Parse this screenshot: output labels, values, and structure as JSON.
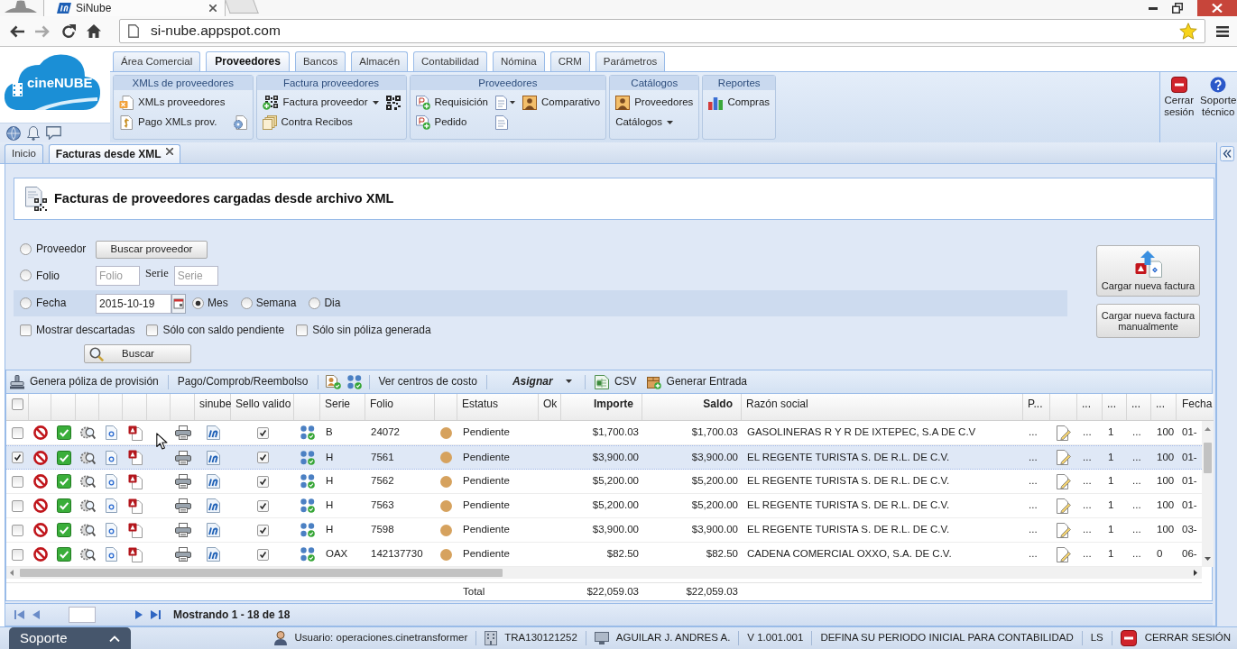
{
  "browser": {
    "tab": {
      "title": "SiNube"
    },
    "url": "si-nube.appspot.com"
  },
  "logo": {
    "text": "cineNUBE"
  },
  "main_tabs": [
    {
      "label": "Área Comercial",
      "selected": false
    },
    {
      "label": "Proveedores",
      "selected": true
    },
    {
      "label": "Bancos",
      "selected": false
    },
    {
      "label": "Almacén",
      "selected": false
    },
    {
      "label": "Contabilidad",
      "selected": false
    },
    {
      "label": "Nómina",
      "selected": false
    },
    {
      "label": "CRM",
      "selected": false
    },
    {
      "label": "Parámetros",
      "selected": false
    }
  ],
  "ribbon": [
    {
      "title": "XMLs de proveedores",
      "rows": [
        [
          {
            "kind": "button",
            "label": "XMLs proveedores"
          }
        ],
        [
          {
            "kind": "button",
            "label": "Pago XMLs prov."
          },
          {
            "kind": "icon"
          }
        ]
      ]
    },
    {
      "title": "Factura proveedores",
      "rows": [
        [
          {
            "kind": "menu",
            "label": "Factura proveedor"
          },
          {
            "kind": "icon"
          }
        ],
        [
          {
            "kind": "button",
            "label": "Contra Recibos"
          }
        ]
      ]
    },
    {
      "title": "Proveedores",
      "rows": [
        [
          {
            "kind": "button",
            "label": "Requisición"
          },
          {
            "kind": "iconmenu"
          },
          {
            "kind": "button",
            "label": "Comparativo"
          }
        ],
        [
          {
            "kind": "button",
            "label": "Pedido"
          },
          {
            "kind": "icon"
          }
        ]
      ]
    },
    {
      "title": "Catálogos",
      "rows": [
        [
          {
            "kind": "button",
            "label": "Proveedores"
          }
        ],
        [
          {
            "kind": "textmenu",
            "label": "Catálogos"
          }
        ]
      ]
    },
    {
      "title": "Reportes",
      "rows": [
        [
          {
            "kind": "button",
            "label": "Compras"
          }
        ]
      ]
    }
  ],
  "session_buttons": [
    {
      "kind": "logout",
      "label": "Cerrar sesión"
    },
    {
      "kind": "help",
      "label": "Soporte técnico"
    }
  ],
  "document_tabs": [
    {
      "label": "Inicio",
      "selected": false,
      "closable": false
    },
    {
      "label": "Facturas desde XML",
      "selected": true,
      "closable": true
    }
  ],
  "page_title": "Facturas de proveedores cargadas desde archivo XML",
  "filters": {
    "criteria": [
      {
        "kind": "button",
        "label": "Proveedor",
        "selected": false,
        "highlighted": false,
        "button": "Buscar proveedor"
      },
      {
        "kind": "fields",
        "label": "Folio",
        "selected": false,
        "highlighted": false,
        "fields": [
          {
            "placeholder": "Folio"
          },
          {
            "label": "Serie",
            "placeholder": "Serie"
          }
        ]
      },
      {
        "kind": "date",
        "label": "Fecha",
        "selected": false,
        "highlighted": true,
        "value": "2015-10-19",
        "periods": [
          {
            "label": "Mes",
            "selected": true
          },
          {
            "label": "Semana",
            "selected": false
          },
          {
            "label": "Dia",
            "selected": false
          }
        ]
      }
    ],
    "options": [
      {
        "label": "Mostrar descartadas",
        "checked": false
      },
      {
        "label": "Sólo con saldo pendiente",
        "checked": false
      },
      {
        "label": "Sólo sin póliza generada",
        "checked": false
      }
    ],
    "search_button": "Buscar"
  },
  "upload_buttons": [
    {
      "kind": "icon",
      "label": "Cargar nueva factura"
    },
    {
      "kind": "text",
      "label": "Cargar nueva factura manualmente"
    }
  ],
  "toolbar": [
    [
      {
        "kind": "icon-button",
        "label": "Genera póliza de provisión"
      }
    ],
    [
      {
        "kind": "button",
        "label": "Pago/Comprob/Reembolso"
      }
    ],
    [
      {
        "kind": "icon"
      },
      {
        "kind": "icon"
      }
    ],
    [
      {
        "kind": "button",
        "label": "Ver centros de costo"
      }
    ],
    [
      {
        "kind": "menu",
        "label": "Asignar"
      }
    ],
    [
      {
        "kind": "icon-button",
        "label": "CSV"
      },
      {
        "kind": "icon-button",
        "label": "Generar Entrada"
      }
    ]
  ],
  "grid": {
    "columns": [
      {
        "kind": "select",
        "checked": false
      },
      {
        "kind": "icon"
      },
      {
        "kind": "icon"
      },
      {
        "kind": "icon"
      },
      {
        "kind": "icon"
      },
      {
        "kind": "icon"
      },
      {
        "kind": "blank"
      },
      {
        "kind": "icon"
      },
      {
        "kind": "icon",
        "label": "sinube"
      },
      {
        "kind": "check",
        "label": "Sello valido"
      },
      {
        "kind": "icon"
      },
      {
        "kind": "text",
        "label": "Serie"
      },
      {
        "kind": "text",
        "label": "Folio"
      },
      {
        "kind": "dot"
      },
      {
        "kind": "text",
        "label": "Estatus",
        "total": "Total"
      },
      {
        "kind": "blank",
        "label": "Ok"
      },
      {
        "kind": "money",
        "label": "Importe",
        "total": "$22,059.03"
      },
      {
        "kind": "money",
        "label": "Saldo",
        "total": "$22,059.03"
      },
      {
        "kind": "text",
        "label": "Razón social"
      },
      {
        "kind": "text",
        "label": "P..."
      },
      {
        "kind": "icon"
      },
      {
        "kind": "text",
        "label": "..."
      },
      {
        "kind": "text",
        "label": "..."
      },
      {
        "kind": "text",
        "label": "..."
      },
      {
        "kind": "text",
        "label": "..."
      },
      {
        "kind": "text",
        "label": "Fecha"
      }
    ],
    "rows": [
      {
        "selected": false,
        "sello_valido": true,
        "color": "#d6a25e",
        "cells": [
          "",
          "",
          "",
          "",
          "",
          "",
          "",
          "",
          "",
          "",
          "",
          "B",
          "24072",
          "",
          "Pendiente",
          "",
          "$1,700.03",
          "$1,700.03",
          "GASOLINERAS R Y R DE IXTEPEC, S.A DE C.V",
          "...",
          "",
          "...",
          "1",
          "...",
          "100",
          "01-"
        ]
      },
      {
        "selected": true,
        "sello_valido": true,
        "color": "#d6a25e",
        "cells": [
          "",
          "",
          "",
          "",
          "",
          "",
          "",
          "",
          "",
          "",
          "",
          "H",
          "7561",
          "",
          "Pendiente",
          "",
          "$3,900.00",
          "$3,900.00",
          "EL REGENTE TURISTA S. DE R.L. DE C.V.",
          "...",
          "",
          "...",
          "1",
          "...",
          "100",
          "01-"
        ]
      },
      {
        "selected": false,
        "sello_valido": true,
        "color": "#d6a25e",
        "cells": [
          "",
          "",
          "",
          "",
          "",
          "",
          "",
          "",
          "",
          "",
          "",
          "H",
          "7562",
          "",
          "Pendiente",
          "",
          "$5,200.00",
          "$5,200.00",
          "EL REGENTE TURISTA S. DE R.L. DE C.V.",
          "...",
          "",
          "...",
          "1",
          "...",
          "100",
          "01-"
        ]
      },
      {
        "selected": false,
        "sello_valido": true,
        "color": "#d6a25e",
        "cells": [
          "",
          "",
          "",
          "",
          "",
          "",
          "",
          "",
          "",
          "",
          "",
          "H",
          "7563",
          "",
          "Pendiente",
          "",
          "$5,200.00",
          "$5,200.00",
          "EL REGENTE TURISTA S. DE R.L. DE C.V.",
          "...",
          "",
          "...",
          "1",
          "...",
          "100",
          "01-"
        ]
      },
      {
        "selected": false,
        "sello_valido": true,
        "color": "#d6a25e",
        "cells": [
          "",
          "",
          "",
          "",
          "",
          "",
          "",
          "",
          "",
          "",
          "",
          "H",
          "7598",
          "",
          "Pendiente",
          "",
          "$3,900.00",
          "$3,900.00",
          "EL REGENTE TURISTA S. DE R.L. DE C.V.",
          "...",
          "",
          "...",
          "1",
          "...",
          "100",
          "03-"
        ]
      },
      {
        "selected": false,
        "sello_valido": true,
        "color": "#d6a25e",
        "cells": [
          "",
          "",
          "",
          "",
          "",
          "",
          "",
          "",
          "",
          "",
          "",
          "OAX",
          "142137730",
          "",
          "Pendiente",
          "",
          "$82.50",
          "$82.50",
          "CADENA COMERCIAL OXXO, S.A. DE C.V.",
          "...",
          "",
          "...",
          "1",
          "...",
          "0",
          "06-"
        ]
      }
    ]
  },
  "pager": {
    "summary": "Mostrando 1 - 18 de 18"
  },
  "support_tab": {
    "label": "Soporte"
  },
  "status_bar": [
    {
      "kind": "user",
      "label": "Usuario: operaciones.cinetransformer"
    },
    {
      "kind": "company",
      "label": "TRA130121252"
    },
    {
      "kind": "computer",
      "label": "AGUILAR J. ANDRES A."
    },
    {
      "kind": "text",
      "label": "V 1.001.001"
    },
    {
      "kind": "text",
      "label": "DEFINA SU PERIODO INICIAL PARA CONTABILIDAD"
    },
    {
      "kind": "text",
      "label": "LS"
    },
    {
      "kind": "logout",
      "label": "CERRAR SESIÓN"
    }
  ]
}
